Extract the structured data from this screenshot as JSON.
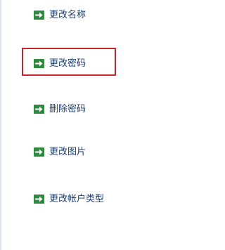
{
  "tasks": [
    {
      "label": "更改名称",
      "icon": "green-arrow-icon"
    },
    {
      "label": "更改密码",
      "icon": "green-arrow-icon"
    },
    {
      "label": "删除密码",
      "icon": "green-arrow-icon"
    },
    {
      "label": "更改图片",
      "icon": "green-arrow-icon"
    },
    {
      "label": "更改帐户类型",
      "icon": "green-arrow-icon"
    }
  ],
  "highlighted_task": "更改密码",
  "colors": {
    "link_text": "#1a3e73",
    "icon_background": "#2d8a3e",
    "highlight_border": "#c0262d"
  }
}
